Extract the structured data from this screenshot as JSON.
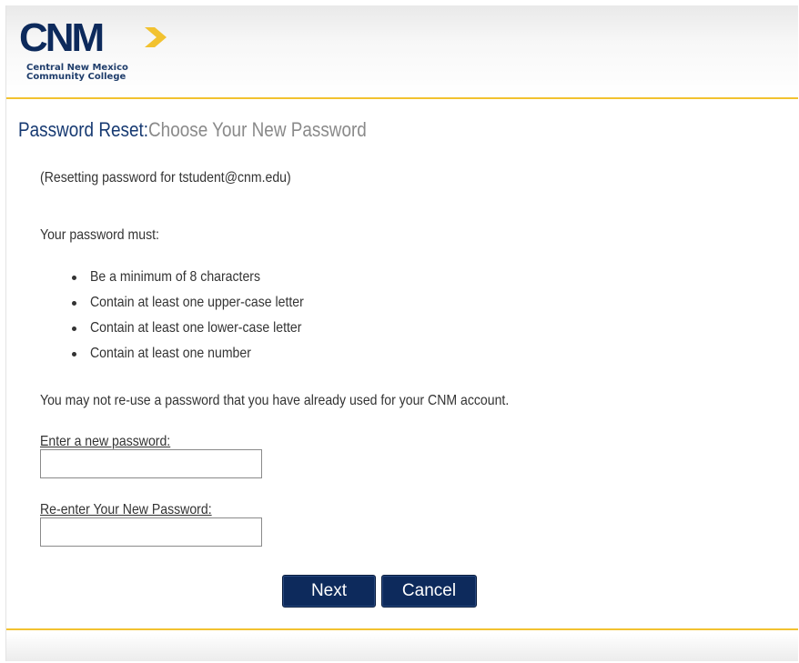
{
  "brand": {
    "logo_word": "CNM",
    "logo_line1": "Central New Mexico",
    "logo_line2": "Community College",
    "navy": "#0d2a5c",
    "gold": "#f2c230"
  },
  "header": {
    "title_main": "Password Reset:",
    "title_sub": "Choose Your New Password"
  },
  "content": {
    "resetting": "(Resetting password for tstudent@cnm.edu)",
    "must_heading": "Your password must:",
    "rules": [
      "Be a minimum of 8 characters",
      "Contain at least one upper-case letter",
      "Contain at least one lower-case letter",
      "Contain at least one number"
    ],
    "reuse_note": "You may not re-use a password that you have already used for your CNM account."
  },
  "form": {
    "new_password_label": "Enter a new password:",
    "new_password_value": "",
    "confirm_password_label": "Re-enter Your New Password:",
    "confirm_password_value": "",
    "next_label": "Next",
    "cancel_label": "Cancel"
  }
}
